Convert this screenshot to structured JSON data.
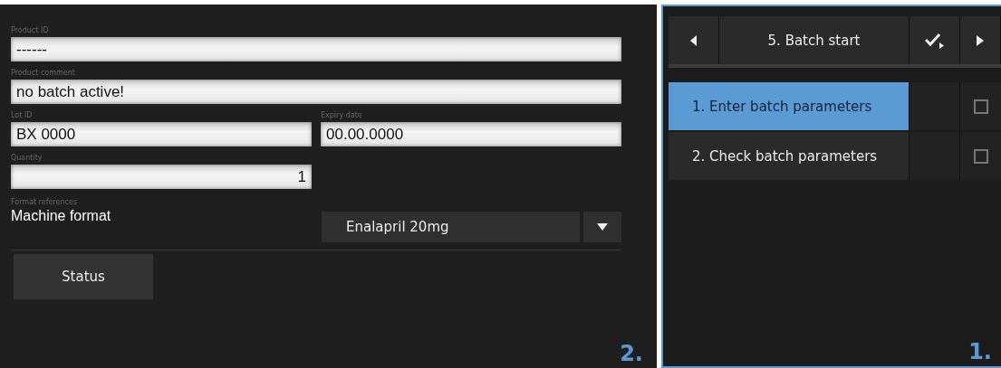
{
  "form": {
    "fields": [
      {
        "label": "Product ID",
        "value": "------"
      },
      {
        "label": "Product comment",
        "value": "no batch active!"
      },
      {
        "label": "Lot ID",
        "value": "BX 0000"
      },
      {
        "label": "Expiry date",
        "value": "00.00.0000"
      },
      {
        "label": "Quantity",
        "value": "1"
      }
    ],
    "format_references": {
      "label": "Format references",
      "name": "Machine format",
      "dropdown_value": "Enalapril 20mg"
    },
    "status_button": "Status",
    "panel_number": "2."
  },
  "workflow": {
    "step_title": "5. Batch start",
    "steps": [
      {
        "label": "1. Enter batch parameters",
        "selected": true,
        "checked": false
      },
      {
        "label": "2. Check batch parameters",
        "selected": false,
        "checked": false
      }
    ],
    "panel_number": "1."
  }
}
